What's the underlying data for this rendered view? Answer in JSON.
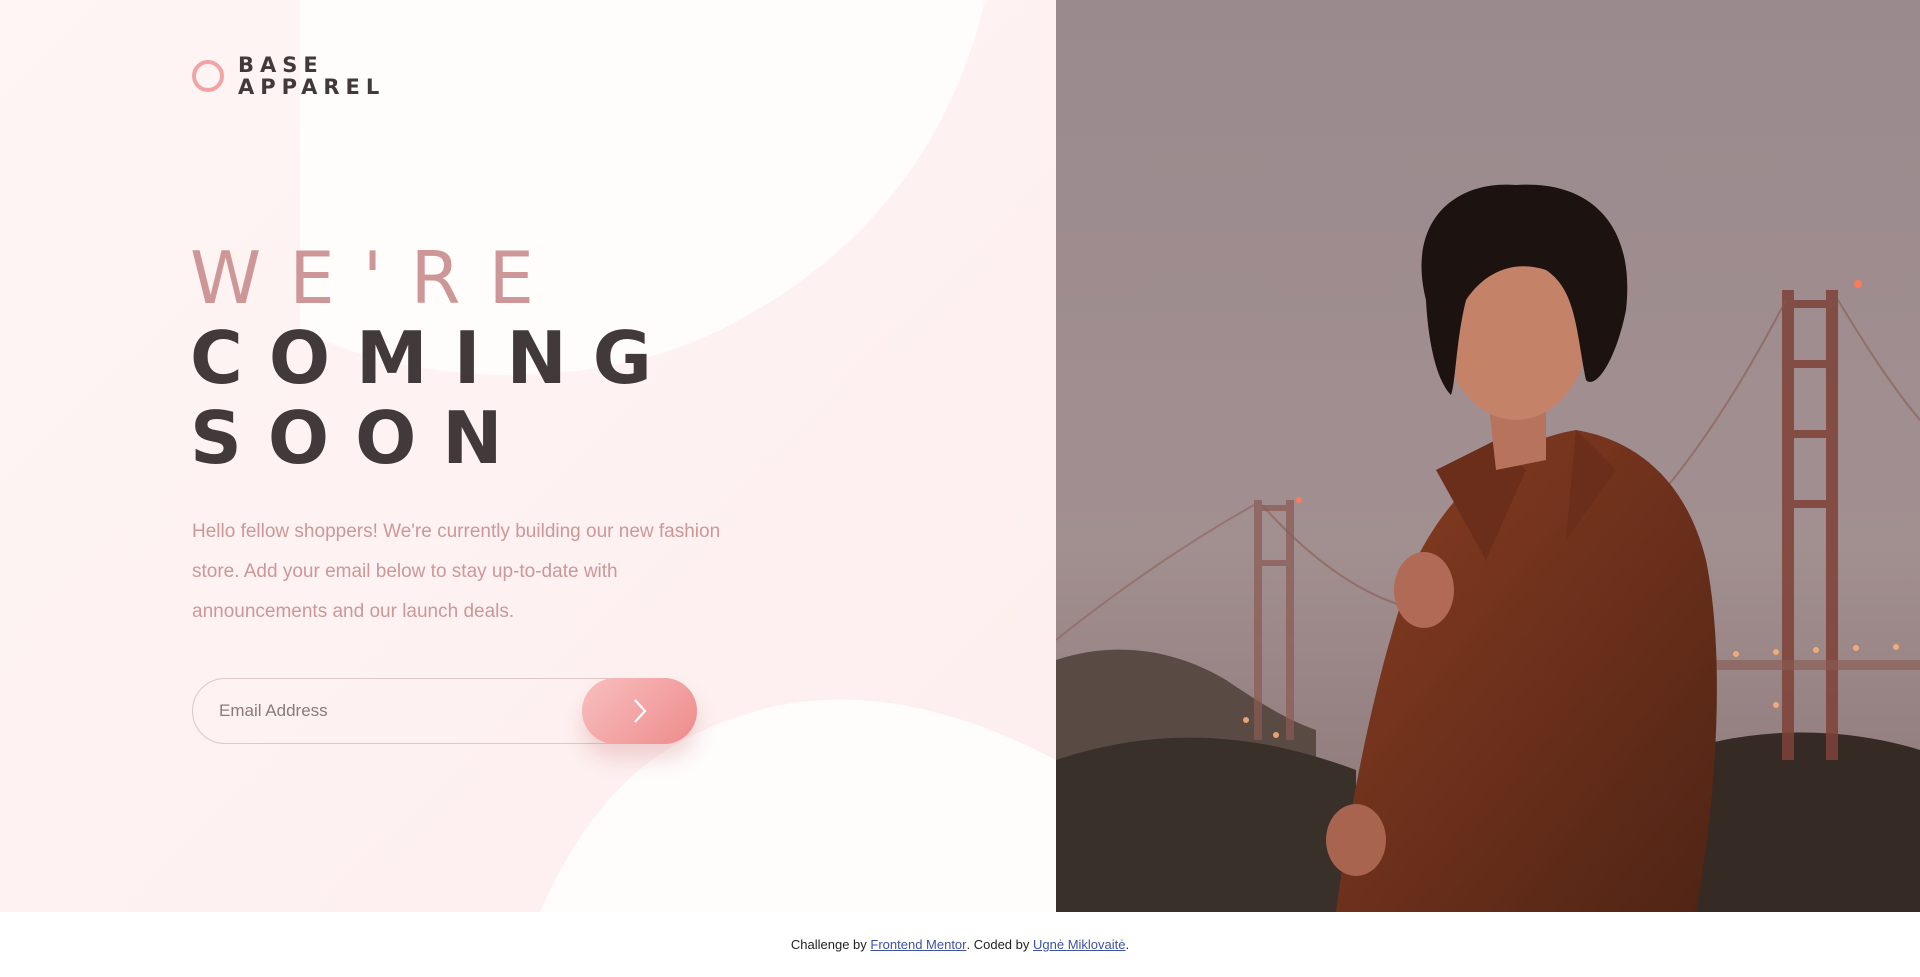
{
  "brand": {
    "line1": "BASE",
    "line2": "APPAREL",
    "accent_color": "#f2a3a3",
    "text_color": "#423a3a"
  },
  "hero": {
    "headline_light": "WE'RE",
    "headline_dark_1": "COMING",
    "headline_dark_2": "SOON",
    "description": "Hello fellow shoppers! We're currently building our new fashion store. Add your email below to stay up-to-date with announcements and our launch deals.",
    "text_color": "#ce9797"
  },
  "form": {
    "email_placeholder": "Email Address",
    "submit_icon": "chevron-right-icon"
  },
  "footer": {
    "prefix": "Challenge by ",
    "link1": "Frontend Mentor",
    "middle": ". Coded by ",
    "link2": "Ugnė Miklovaitė",
    "suffix": ".",
    "link_color": "#3e52a3"
  },
  "image": {
    "subject": "hero-photo"
  }
}
